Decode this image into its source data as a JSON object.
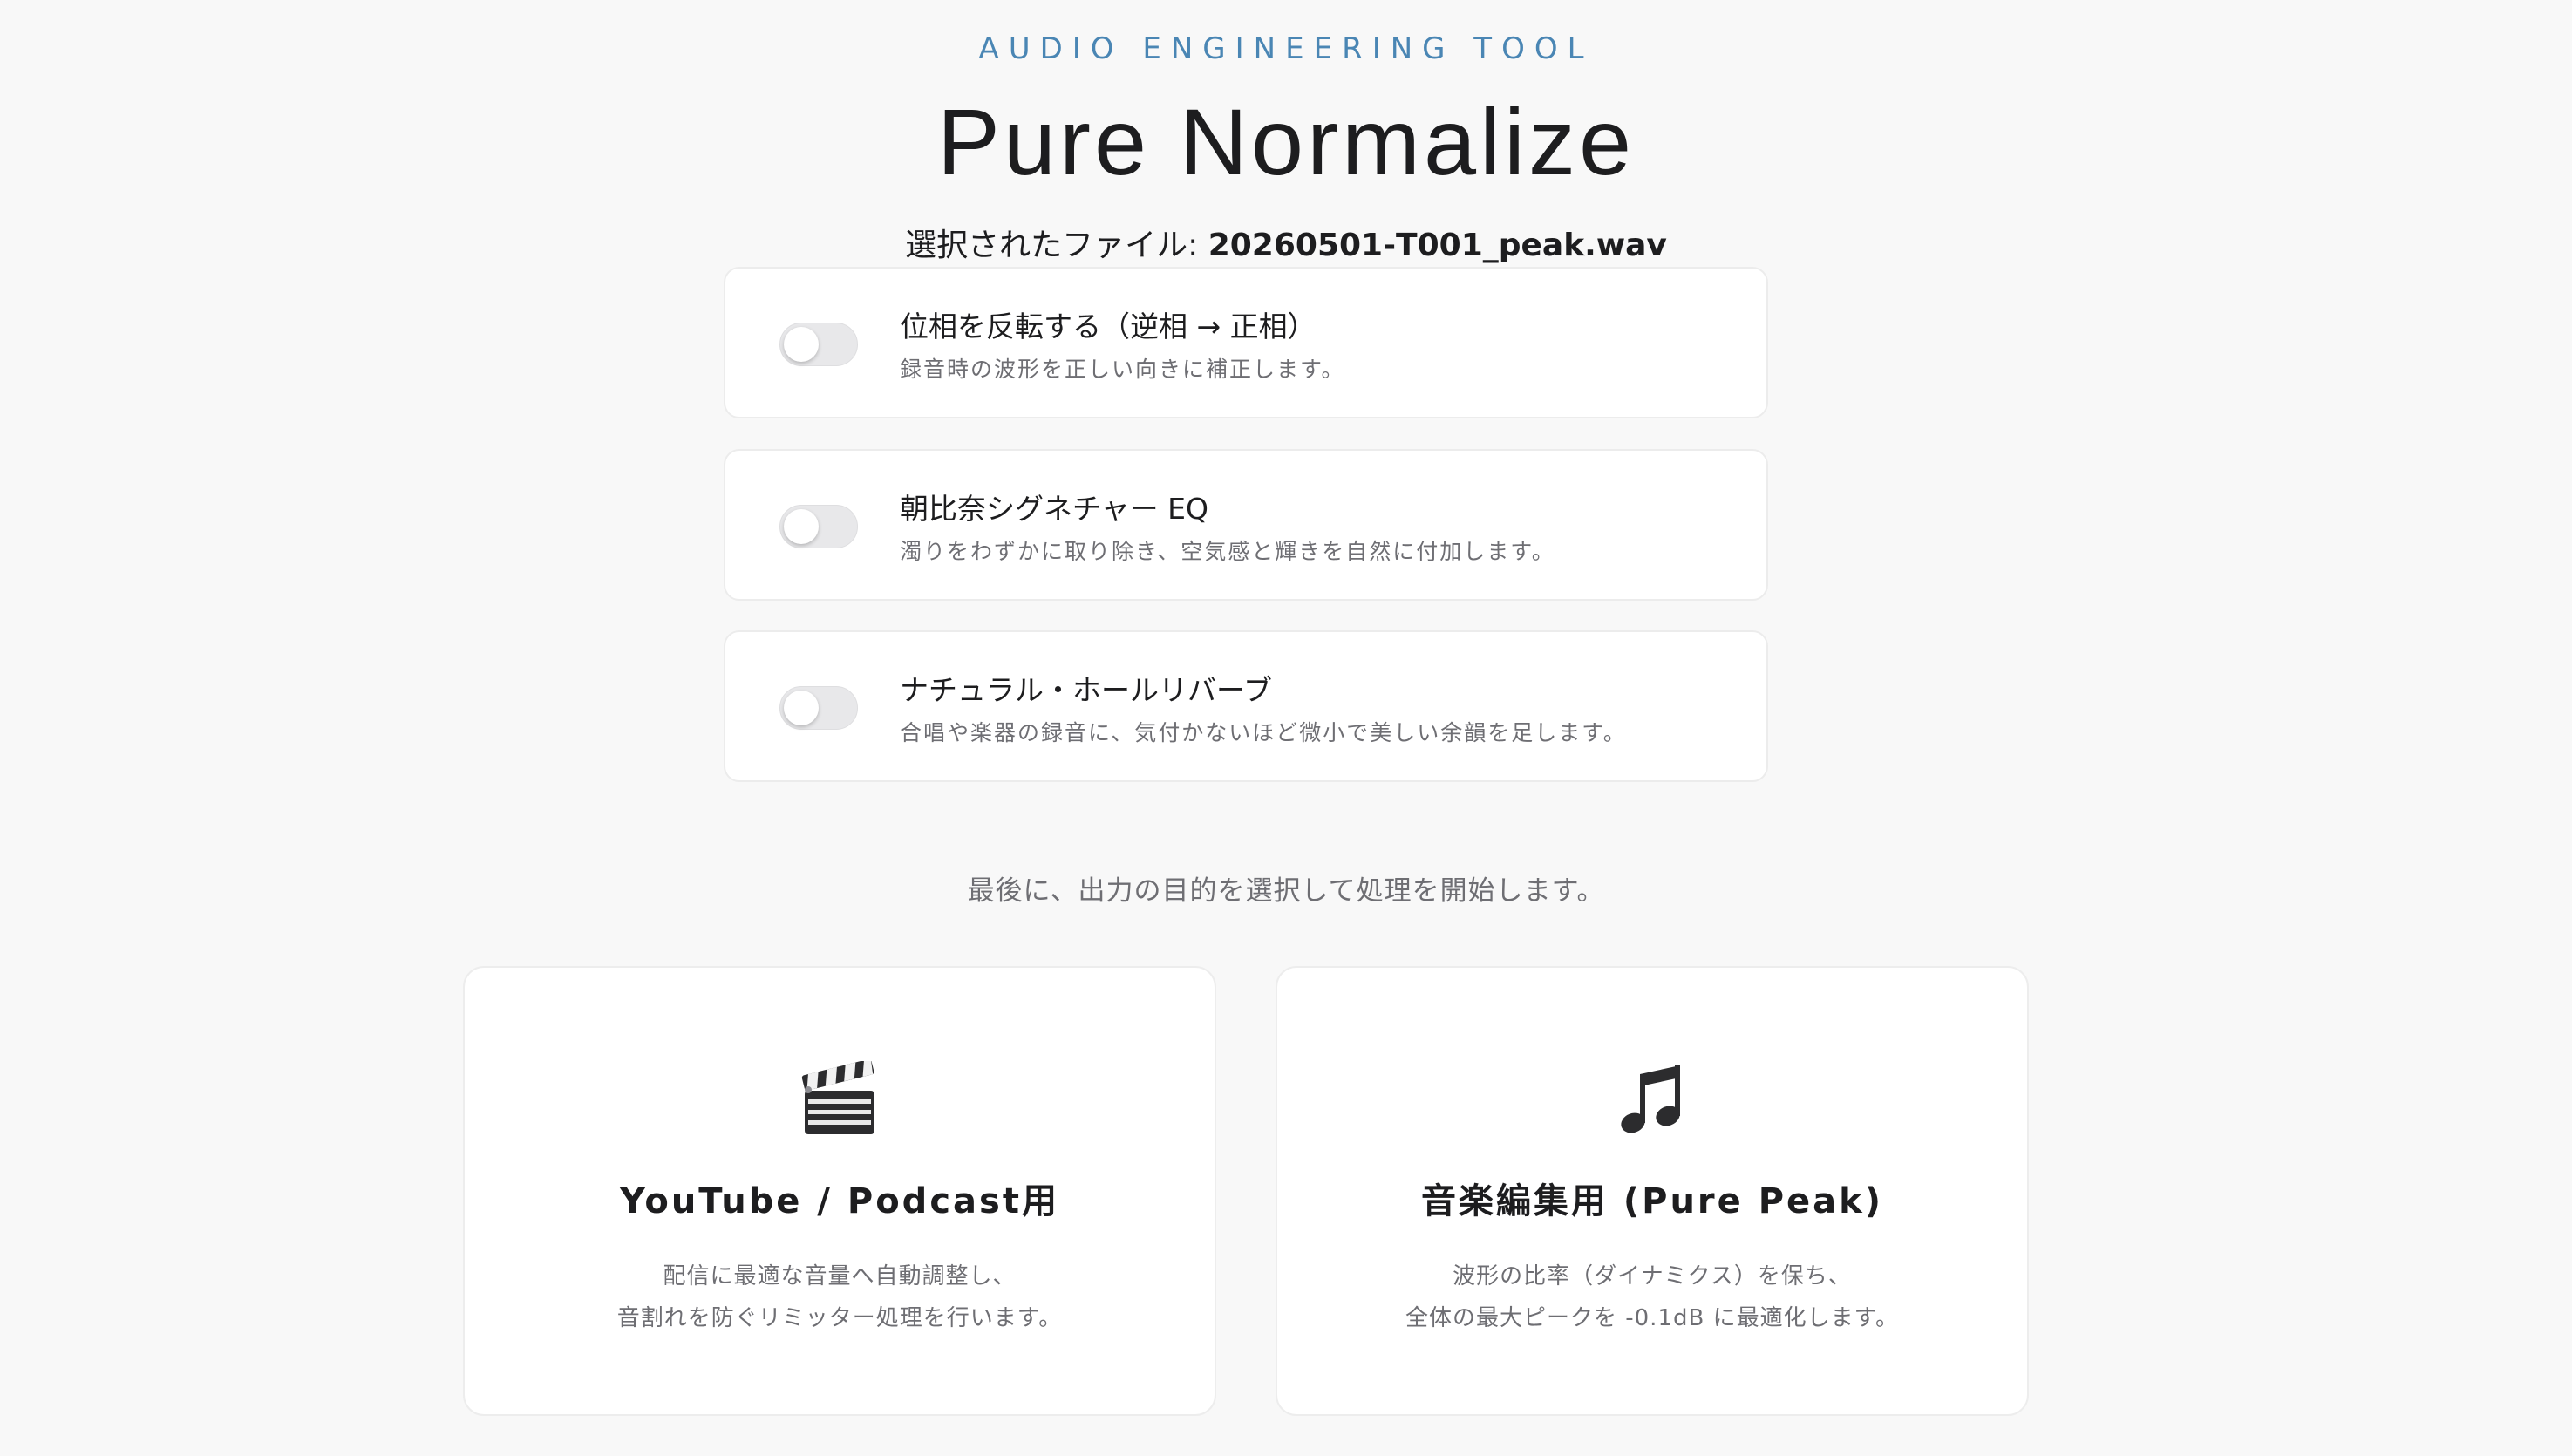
{
  "header": {
    "eyebrow": "AUDIO ENGINEERING TOOL",
    "title": "Pure Normalize",
    "file_label": "選択されたファイル: ",
    "file_name": "20260501-T001_peak.wav"
  },
  "options": [
    {
      "title": "位相を反転する（逆相 → 正相）",
      "description": "録音時の波形を正しい向きに補正します。",
      "enabled": false
    },
    {
      "title": "朝比奈シグネチャー EQ",
      "description": "濁りをわずかに取り除き、空気感と輝きを自然に付加します。",
      "enabled": false
    },
    {
      "title": "ナチュラル・ホールリバーブ",
      "description": "合唱や楽器の録音に、気付かないほど微小で美しい余韻を足します。",
      "enabled": false
    }
  ],
  "prompt": "最後に、出力の目的を選択して処理を開始します。",
  "modes": [
    {
      "icon": "clapperboard-icon",
      "title": "YouTube / Podcast用",
      "desc_line1": "配信に最適な音量へ自動調整し、",
      "desc_line2": "音割れを防ぐリミッター処理を行います。"
    },
    {
      "icon": "music-note-icon",
      "title": "音楽編集用 (Pure Peak)",
      "desc_line1": "波形の比率（ダイナミクス）を保ち、",
      "desc_line2": "全体の最大ピークを -0.1dB に最適化します。"
    }
  ],
  "colors": {
    "accent": "#4a86b4",
    "background": "#f8f8f8",
    "text": "#1d1d1f",
    "muted": "#6e6e73"
  }
}
